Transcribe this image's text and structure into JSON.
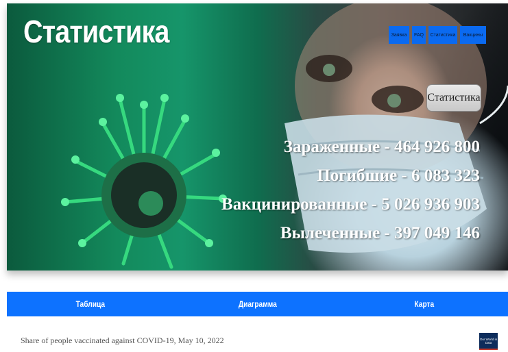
{
  "hero": {
    "title": "Статистика",
    "nav": [
      "Заявка",
      "FAQ",
      "Статистика",
      "Вакцины"
    ],
    "stats_button": "Статистика",
    "stats": [
      "Зараженные - 464 926 800",
      "Погибшие - 6 083 323",
      "Вакцинированные - 5 026 936 903",
      "Вылеченные - 397 049 146"
    ]
  },
  "tabs": [
    "Таблица",
    "Диаграмма",
    "Карта"
  ],
  "chart_caption": "Share of people vaccinated against COVID-19, May 10, 2022",
  "logo_text": "Our World in Data",
  "colors": {
    "accent": "#0d72ff",
    "nav": "#0b6af0"
  }
}
